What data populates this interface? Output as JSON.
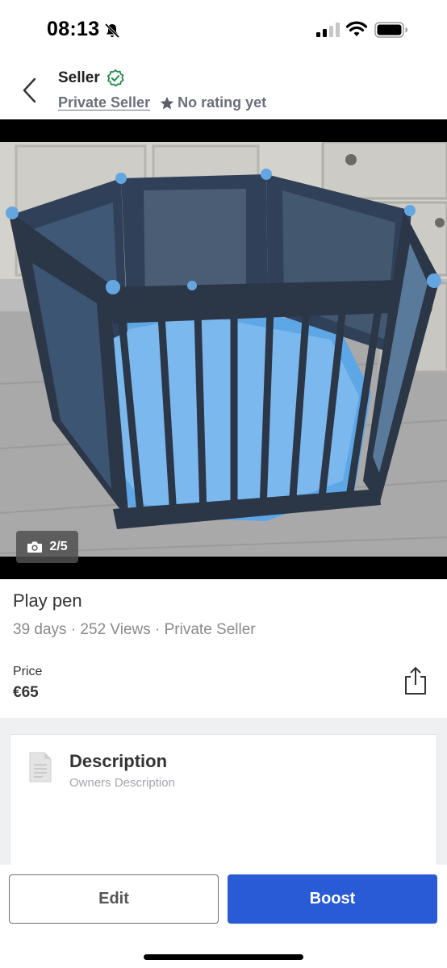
{
  "status_bar": {
    "time": "08:13",
    "icons": [
      "bell-slash-icon",
      "signal-icon",
      "wifi-icon",
      "battery-icon"
    ]
  },
  "header": {
    "title": "Seller",
    "verified_icon": "verified-badge-icon",
    "seller_type": "Private Seller",
    "rating_text": "No rating yet",
    "back_icon": "chevron-left-icon"
  },
  "photo": {
    "counter": "2/5",
    "counter_icon": "camera-icon"
  },
  "listing": {
    "title": "Play pen",
    "meta": "39 days · 252 Views · Private Seller",
    "price_label": "Price",
    "price_value": "€65",
    "share_icon": "share-icon"
  },
  "description": {
    "title": "Description",
    "subtitle": "Owners Description",
    "icon": "document-icon"
  },
  "actions": {
    "edit_label": "Edit",
    "boost_label": "Boost"
  },
  "colors": {
    "boost": "#2a5bd7",
    "verified": "#1f8a4c",
    "muted_text": "#6b6f7a"
  }
}
